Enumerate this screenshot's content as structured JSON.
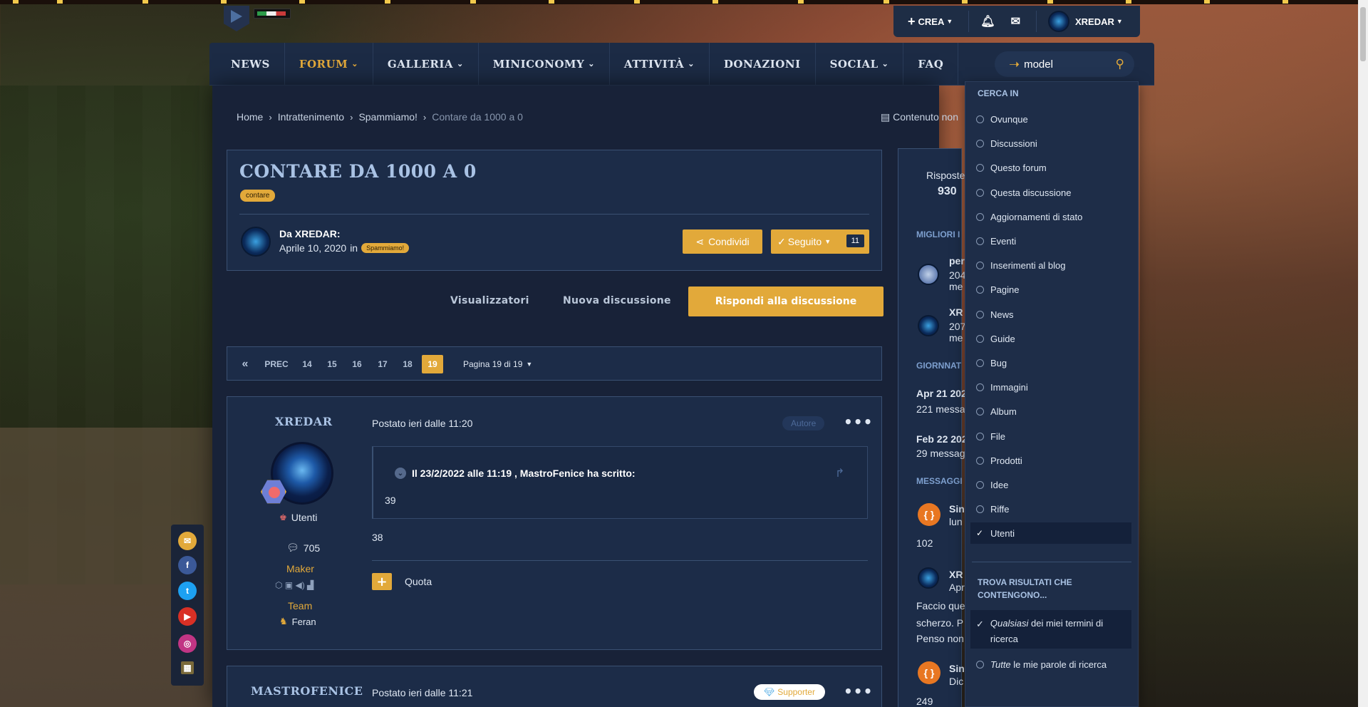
{
  "userbar": {
    "create": "CREA",
    "username": "XREDAR"
  },
  "nav": {
    "items": [
      {
        "label": "NEWS"
      },
      {
        "label": "FORUM"
      },
      {
        "label": "GALLERIA"
      },
      {
        "label": "MINICONOMY"
      },
      {
        "label": "ATTIVITÀ"
      },
      {
        "label": "DONAZIONI"
      },
      {
        "label": "SOCIAL"
      },
      {
        "label": "FAQ"
      }
    ]
  },
  "search": {
    "value": "model"
  },
  "breadcrumb": {
    "items": [
      "Home",
      "Intrattenimento",
      "Spammiamo!",
      "Contare da 1000 a 0"
    ],
    "unread": "Contenuto non"
  },
  "thread": {
    "title": "CONTARE DA 1000 A 0",
    "tag": "contare",
    "by": "Da XREDAR:",
    "date": "Aprile 10, 2020",
    "in": "in",
    "forum_tag": "Spammiamo!",
    "share": "Condividi",
    "follow": "Seguito",
    "follow_count": "11"
  },
  "actions": {
    "viewers": "Visualizzatori",
    "new": "Nuova discussione",
    "reply": "Rispondi alla discussione"
  },
  "pager": {
    "prev": "PREC",
    "pages": [
      "14",
      "15",
      "16",
      "17",
      "18"
    ],
    "current": "19",
    "pages_label": "Pagina 19 di 19"
  },
  "post1": {
    "author": "XREDAR",
    "group": "Utenti",
    "posts": "705",
    "rank": "Maker",
    "team_label": "Team",
    "team": "Feran",
    "posted": "Postato ieri dalle 11:20",
    "badge": "Autore",
    "quote_head": "Il 23/2/2022 alle 11:19 , MastroFenice ha scritto:",
    "quote_body": "39",
    "body": "38",
    "quote_btn": "Quota"
  },
  "post2": {
    "author": "MASTROFENICE",
    "posted": "Postato ieri dalle 11:21",
    "badge": "Supporter"
  },
  "sidebar": {
    "risposte_label": "Risposte",
    "risposte": "930",
    "migliori": "MIGLIORI I",
    "u1_name": "per",
    "u1_a": "204",
    "u1_b": "me",
    "u2_name": "XR",
    "u2_a": "207",
    "u2_b": "me",
    "giorni": "GIORNNAT",
    "d1": "Apr 21 202",
    "d1b": "221 messa",
    "d2": "Feb 22 202",
    "d2b": "29 messag",
    "messaggi": "MESSAGGI",
    "m1a": "Sin",
    "m1b": "lun",
    "m1c": "102",
    "m2a": "XR",
    "m2b": "Apr",
    "m2c": "Faccio que",
    "m2d": "scherzo. P",
    "m2e": "Penso non",
    "m3a": "Sin",
    "m3b": "Dic",
    "m3c": "249"
  },
  "dropdown": {
    "heading": "CERCA IN",
    "options": [
      "Ovunque",
      "Discussioni",
      "Questo forum",
      "Questa discussione",
      "Aggiornamenti di stato",
      "Eventi",
      "Inserimenti al blog",
      "Pagine",
      "News",
      "Guide",
      "Bug",
      "Immagini",
      "Album",
      "File",
      "Prodotti",
      "Idee",
      "Riffe",
      "Utenti"
    ],
    "selected": "Utenti",
    "heading2": "TROVA RISULTATI CHE CONTENGONO...",
    "any_em": "Qualsiasi",
    "any_rest": " dei miei termini di ricerca",
    "all_em": "Tutte",
    "all_rest": " le mie parole di ricerca"
  },
  "colors": {
    "accent": "#e2a93a",
    "panel": "#1c2c48",
    "nav": "#1c2b45"
  }
}
